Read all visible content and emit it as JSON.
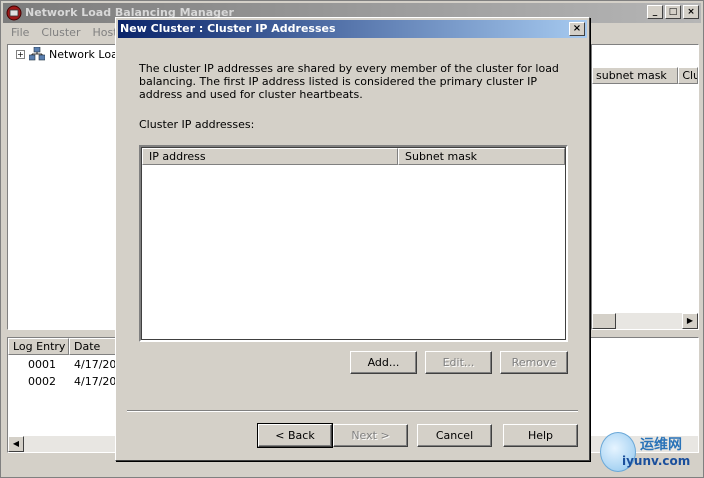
{
  "main_window": {
    "title": "Network Load Balancing Manager",
    "menu": [
      "File",
      "Cluster",
      "Host"
    ],
    "tree_item": "Network Load",
    "right_columns": [
      "subnet mask",
      "Clu"
    ],
    "log_columns": [
      "Log Entry",
      "Date"
    ],
    "log_rows": [
      {
        "entry": "0001",
        "date": "4/17/201"
      },
      {
        "entry": "0002",
        "date": "4/17/201"
      }
    ]
  },
  "dialog": {
    "title": "New Cluster : Cluster IP Addresses",
    "close_label": "×",
    "description": "The cluster IP addresses are shared by every member of the cluster for load balancing. The first IP address listed is considered the primary cluster IP address and used for cluster heartbeats.",
    "list_label": "Cluster IP addresses:",
    "list_columns": [
      "IP address",
      "Subnet mask"
    ],
    "buttons": {
      "add": "Add...",
      "edit": "Edit...",
      "remove": "Remove",
      "back": "< Back",
      "next": "Next >",
      "cancel": "Cancel",
      "help": "Help"
    }
  },
  "watermark": {
    "line1": "运维网",
    "line2": "iyunv.com"
  }
}
